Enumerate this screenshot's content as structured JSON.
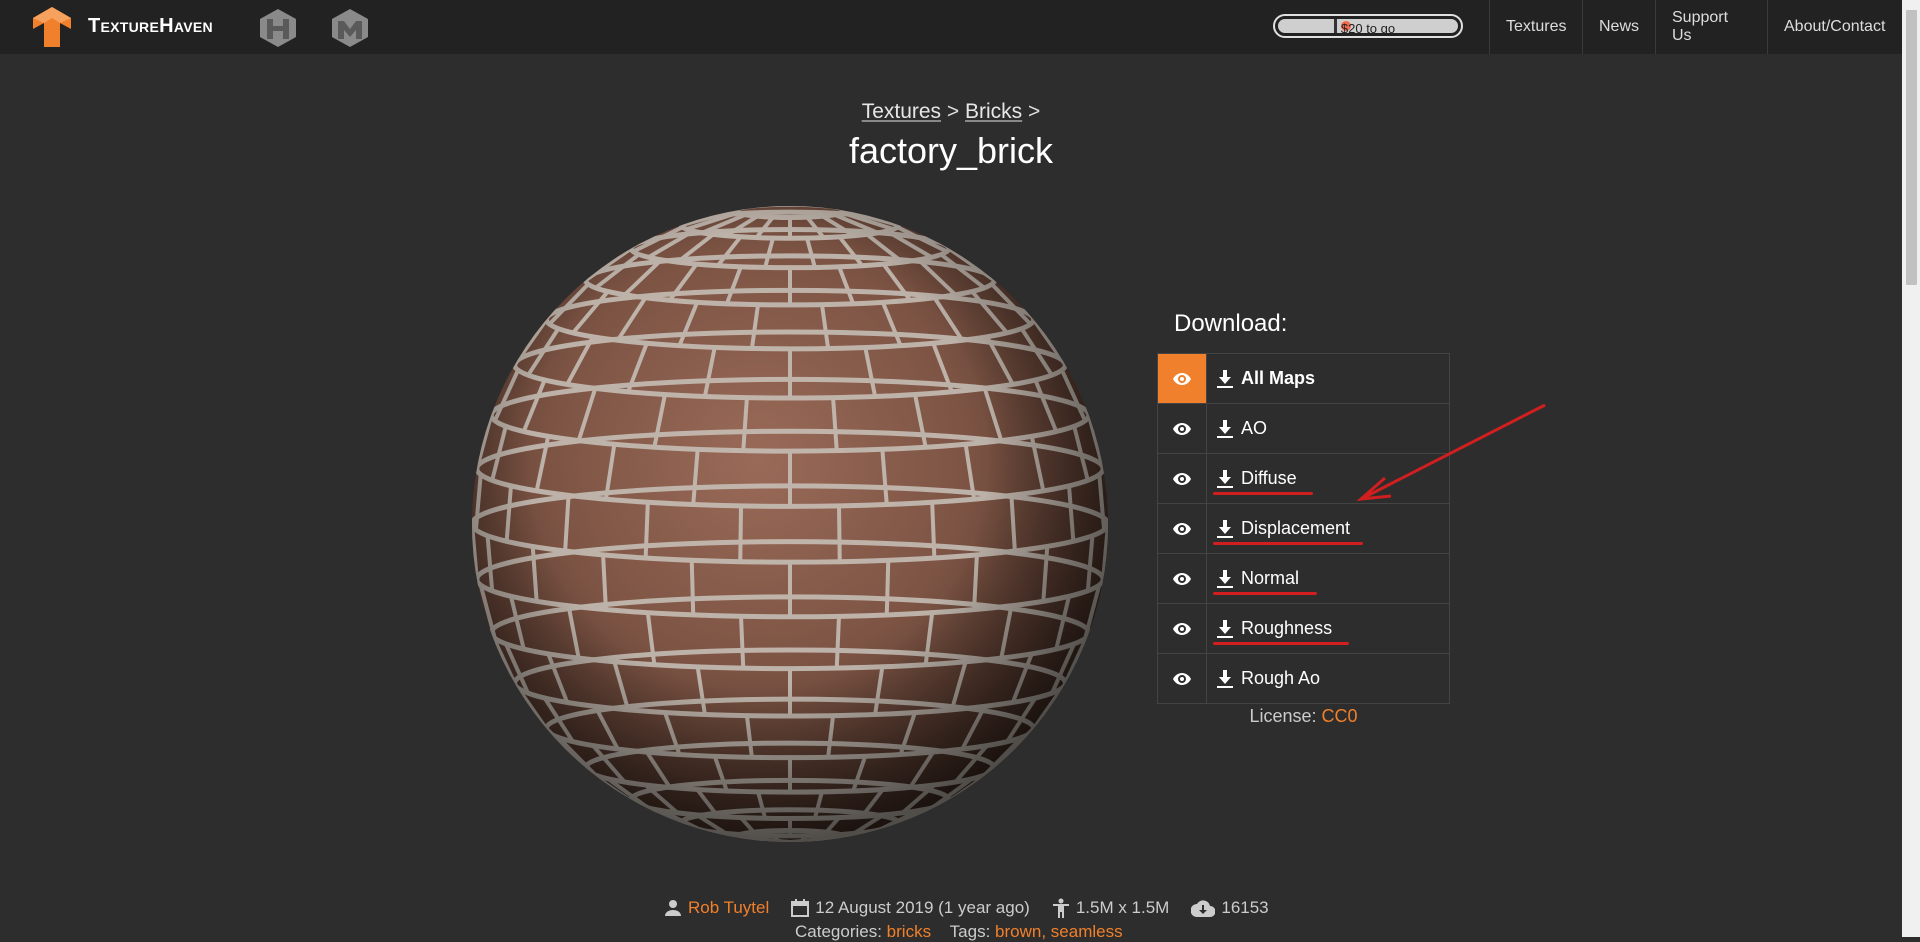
{
  "header": {
    "logo_text": "TextureHaven",
    "icons": [
      "hdrihaven-icon",
      "3dmodelhaven-icon"
    ],
    "progress": {
      "label": "$20 to go",
      "fill_fraction": 0.3
    },
    "nav": [
      "Textures",
      "News",
      "Support Us",
      "About/Contact"
    ]
  },
  "breadcrumb": {
    "item1": "Textures",
    "sep1": ">",
    "item2": "Bricks",
    "sep2": ">"
  },
  "title": "factory_brick",
  "download": {
    "heading": "Download:",
    "items": [
      "All Maps",
      "AO",
      "Diffuse",
      "Displacement",
      "Normal",
      "Roughness",
      "Rough Ao"
    ],
    "active_preview_index": 0
  },
  "license": {
    "label": "License:",
    "value": "CC0"
  },
  "meta": {
    "author": "Rob Tuytel",
    "date": "12 August 2019 (1 year ago)",
    "size": "1.5M x 1.5M",
    "downloads": "16153"
  },
  "meta2": {
    "categories_label": "Categories:",
    "categories": "bricks",
    "tags_label": "Tags:",
    "tags": "brown, seamless"
  },
  "colors": {
    "accent": "#f0802b",
    "annotation": "#d11f1f",
    "background": "#2d2d2d",
    "header": "#222222"
  }
}
